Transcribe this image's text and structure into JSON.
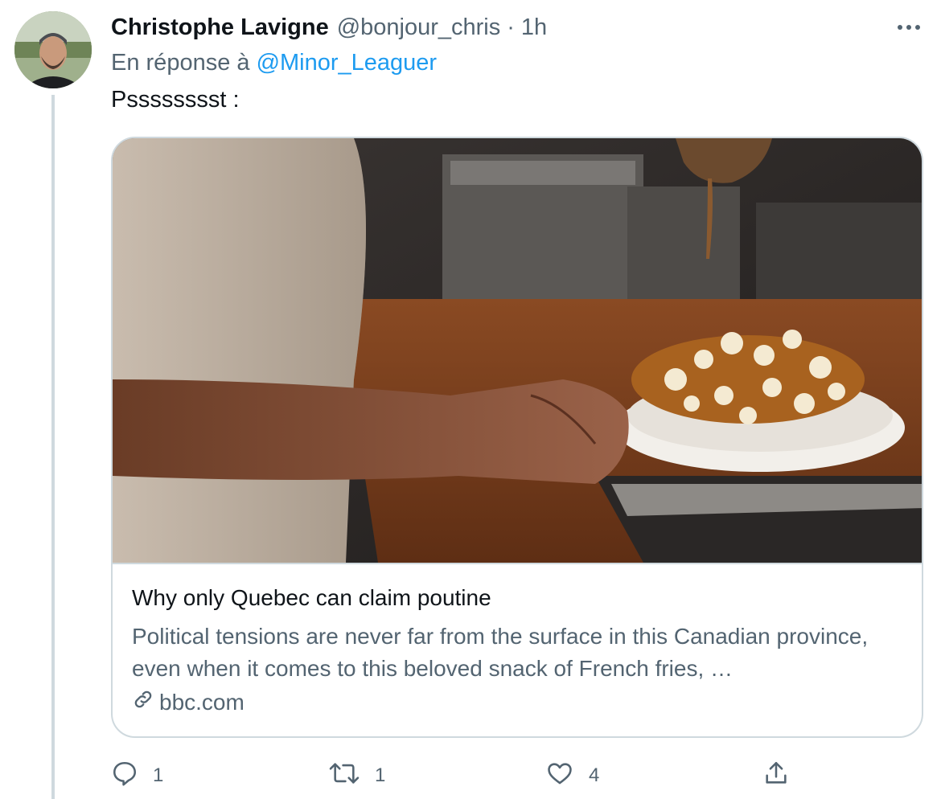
{
  "author": {
    "display_name": "Christophe Lavigne",
    "handle": "@bonjour_chris",
    "separator": "·",
    "time": "1h"
  },
  "reply": {
    "prefix": "En réponse à",
    "mention": "@Minor_Leaguer"
  },
  "tweet": {
    "text": "Psssssssst :"
  },
  "card": {
    "title": "Why only Quebec can claim poutine",
    "description": "Political tensions are never far from the surface in this Canadian province, even when it comes to this beloved snack of French fries, …",
    "domain": "bbc.com"
  },
  "actions": {
    "reply_count": "1",
    "retweet_count": "1",
    "like_count": "4"
  },
  "icons": {
    "more": "more-horizontal-icon",
    "reply": "reply-icon",
    "retweet": "retweet-icon",
    "like": "heart-icon",
    "share": "share-icon",
    "link": "link-icon"
  },
  "colors": {
    "link_blue": "#1d9bf0",
    "secondary_text": "#536471",
    "border": "#cfd9de"
  }
}
